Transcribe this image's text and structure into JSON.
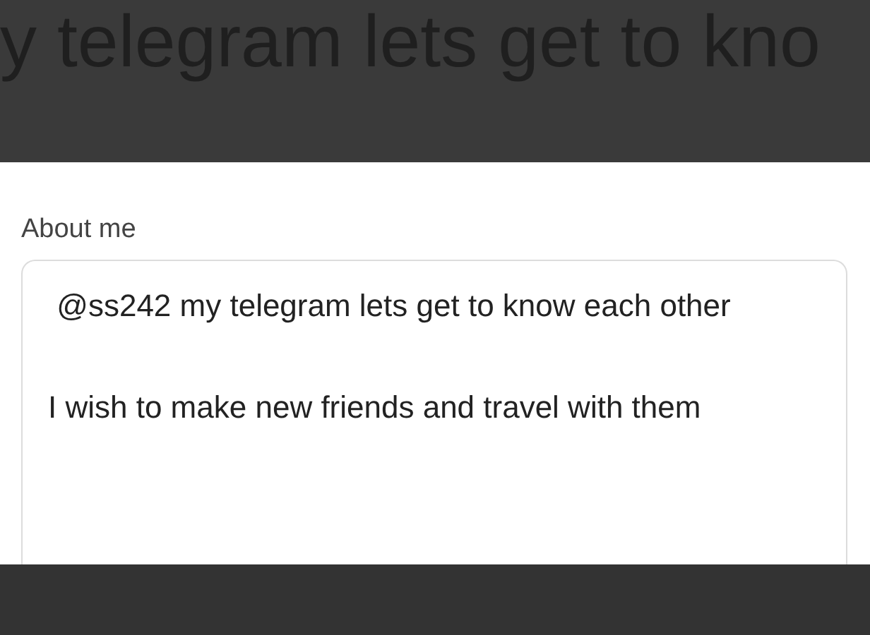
{
  "background_heading": "y telegram lets get to kno",
  "about_field": {
    "label": "About me",
    "value": " @ss242 my telegram lets get to know each other\n\nI wish to make new friends and travel with them"
  }
}
